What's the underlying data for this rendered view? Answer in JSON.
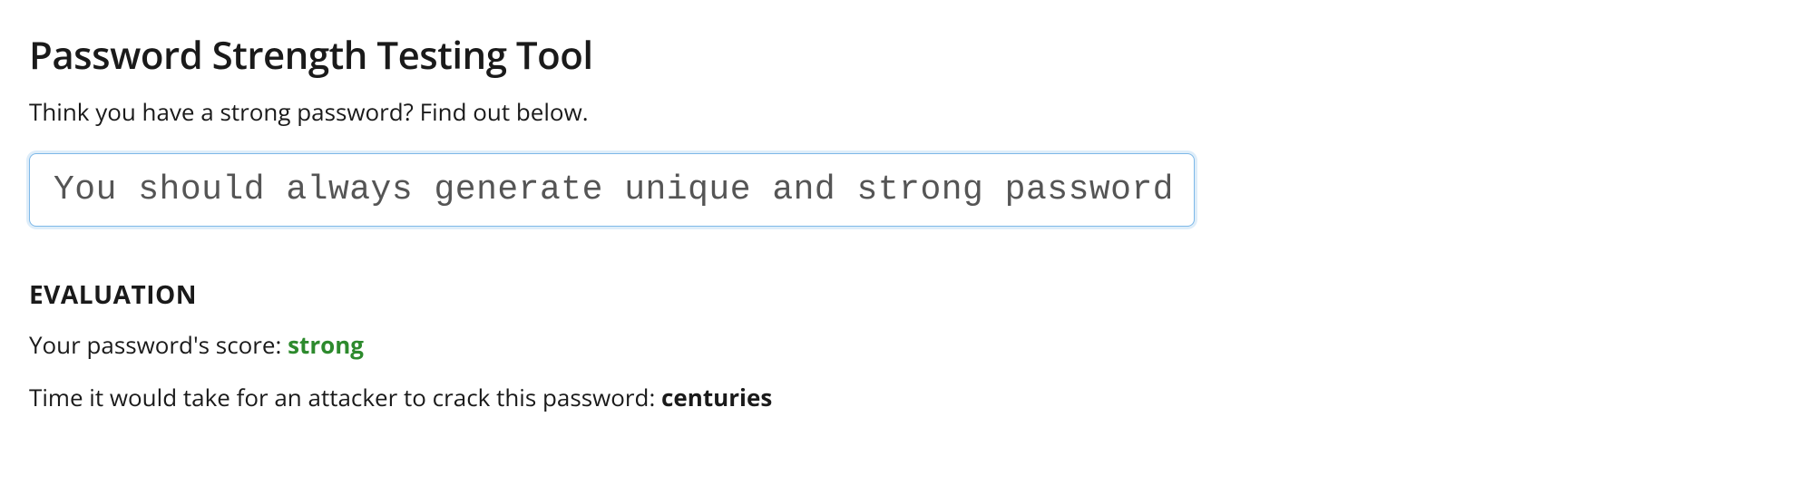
{
  "header": {
    "title": "Password Strength Testing Tool",
    "subtitle": "Think you have a strong password? Find out below."
  },
  "input": {
    "value": "You should always generate unique and strong passwords!"
  },
  "evaluation": {
    "heading": "EVALUATION",
    "score_label": "Your password's score: ",
    "score_value": "strong",
    "crack_time_label": "Time it would take for an attacker to crack this password: ",
    "crack_time_value": "centuries"
  }
}
